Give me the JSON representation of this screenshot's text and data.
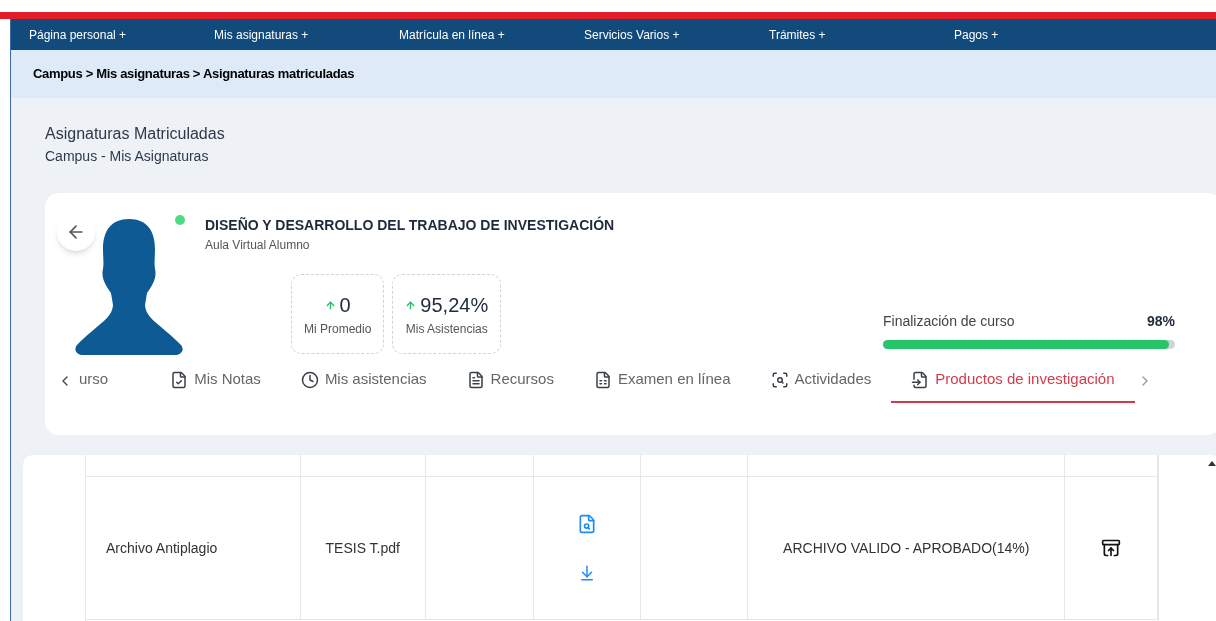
{
  "nav": {
    "items": [
      "Página personal +",
      "Mis asignaturas +",
      "Matrícula en línea +",
      "Servicios Varios +",
      "Trámites +",
      "Pagos +"
    ]
  },
  "breadcrumb": "Campus > Mis asignaturas > Asignaturas matriculadas",
  "page": {
    "title": "Asignaturas Matriculadas",
    "subtitle": "Campus - Mis Asignaturas"
  },
  "course": {
    "title": "DISEÑO Y DESARROLLO DEL TRABAJO DE INVESTIGACIÓN",
    "subtitle": "Aula Virtual Alumno",
    "online": true,
    "stats": [
      {
        "value": "0",
        "label": "Mi Promedio"
      },
      {
        "value": "95,24%",
        "label": "Mis Asistencias"
      }
    ],
    "progress": {
      "label": "Finalización de curso",
      "reading": "98%",
      "level": 0.98
    }
  },
  "tabs": [
    {
      "label": "urso",
      "kind": "none",
      "selected": false
    },
    {
      "label": "Mis Notas",
      "kind": "notes",
      "selected": false
    },
    {
      "label": "Mis asistencias",
      "kind": "clock",
      "selected": false
    },
    {
      "label": "Recursos",
      "kind": "resources",
      "selected": false
    },
    {
      "label": "Examen en línea",
      "kind": "exam",
      "selected": false
    },
    {
      "label": "Actividades",
      "kind": "activities",
      "selected": false
    },
    {
      "label": "Productos de investigación",
      "kind": "products",
      "selected": true
    }
  ],
  "table": {
    "rows": [
      {
        "cells": [
          "Archivo Antiplagio",
          "TESIS T.pdf",
          "",
          "",
          "",
          "ARCHIVO VALIDO - APROBADO(14%)",
          ""
        ]
      }
    ]
  }
}
